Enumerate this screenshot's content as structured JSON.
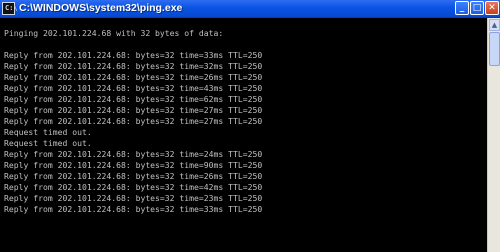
{
  "window": {
    "title": "C:\\WINDOWS\\system32\\ping.exe",
    "icon_text": "C:\\",
    "minimize_glyph": "_",
    "maximize_glyph": "□",
    "close_glyph": "✕"
  },
  "console": {
    "text_color": "#c0c0c0",
    "background": "#000000",
    "lines": [
      "Pinging 202.101.224.68 with 32 bytes of data:",
      "",
      "Reply from 202.101.224.68: bytes=32 time=33ms TTL=250",
      "Reply from 202.101.224.68: bytes=32 time=32ms TTL=250",
      "Reply from 202.101.224.68: bytes=32 time=26ms TTL=250",
      "Reply from 202.101.224.68: bytes=32 time=43ms TTL=250",
      "Reply from 202.101.224.68: bytes=32 time=62ms TTL=250",
      "Reply from 202.101.224.68: bytes=32 time=27ms TTL=250",
      "Reply from 202.101.224.68: bytes=32 time=27ms TTL=250",
      "Request timed out.",
      "Request timed out.",
      "Reply from 202.101.224.68: bytes=32 time=24ms TTL=250",
      "Reply from 202.101.224.68: bytes=32 time=90ms TTL=250",
      "Reply from 202.101.224.68: bytes=32 time=26ms TTL=250",
      "Reply from 202.101.224.68: bytes=32 time=42ms TTL=250",
      "Reply from 202.101.224.68: bytes=32 time=23ms TTL=250",
      "Reply from 202.101.224.68: bytes=32 time=33ms TTL=250"
    ]
  }
}
